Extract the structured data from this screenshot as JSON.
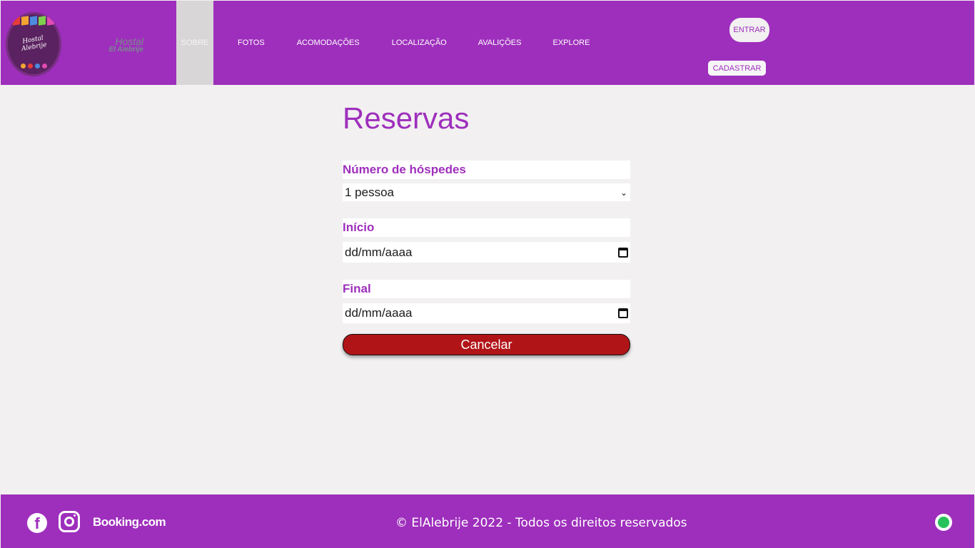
{
  "header": {
    "logo_text": "Hostal Alebrije",
    "brand_line1": "Hostal",
    "brand_line2": "El Alebrije",
    "nav": [
      {
        "label": "SOBRE",
        "active": true
      },
      {
        "label": "FOTOS"
      },
      {
        "label": "ACOMODAÇÕES"
      },
      {
        "label": "LOCALIZAÇÃO"
      },
      {
        "label": "AVALIÇÕES"
      },
      {
        "label": "EXPLORE"
      }
    ],
    "login_label": "ENTRAR",
    "signup_label": "CADASTRAR"
  },
  "form": {
    "title": "Reservas",
    "guests_label": "Número de hóspedes",
    "guests_value": "1 pessoa",
    "start_label": "Início",
    "start_value": "dd/mm/aaaa",
    "end_label": "Final",
    "end_value": "dd/mm/aaaa",
    "cancel_label": "Cancelar"
  },
  "footer": {
    "facebook_icon": "facebook-icon",
    "instagram_icon": "instagram-icon",
    "booking_label": "Booking.com",
    "copyright": "© ElAlebrije 2022 - Todos os direitos reservados",
    "whatsapp_icon": "whatsapp-icon"
  },
  "colors": {
    "brand_purple": "#9e2fbc",
    "cancel_red": "#b11417",
    "background": "#f2f0f1"
  }
}
